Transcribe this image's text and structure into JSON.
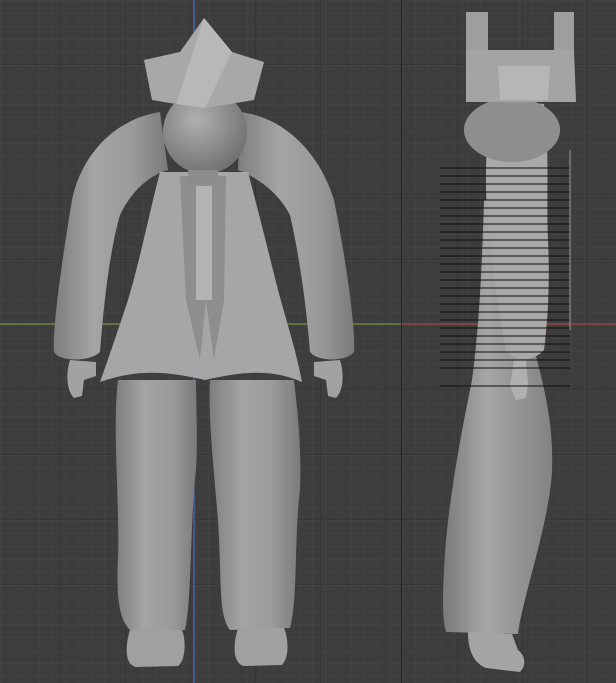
{
  "viewports": [
    {
      "name": "front-view",
      "axis_colors": {
        "x": "#7fa844",
        "z": "#4a72c4"
      }
    },
    {
      "name": "side-view",
      "axis_colors": {
        "y": "#c54848"
      }
    }
  ],
  "colors": {
    "background": "#3d3d3d",
    "grid_minor": "#474747",
    "grid_major": "#2c2c2c",
    "model": "#9a9a9a"
  }
}
